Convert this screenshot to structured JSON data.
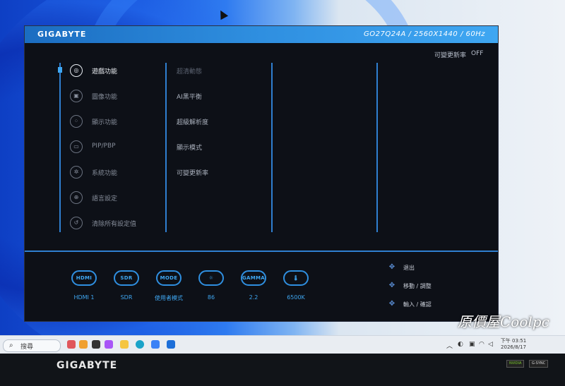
{
  "osd": {
    "brand": "GIGABYTE",
    "model_info": "GO27Q24A / 2560X1440 / 60Hz",
    "top_right_label": "可變更新率",
    "top_right_value": "OFF",
    "menu": [
      {
        "label": "遊戲功能",
        "icon": "gamepad-icon",
        "glyph": "◎",
        "active": true
      },
      {
        "label": "圖像功能",
        "icon": "picture-icon",
        "glyph": "▣",
        "active": false
      },
      {
        "label": "顯示功能",
        "icon": "display-icon",
        "glyph": "⁘",
        "active": false
      },
      {
        "label": "PIP/PBP",
        "icon": "pip-icon",
        "glyph": "▭",
        "active": false
      },
      {
        "label": "系統功能",
        "icon": "gear-icon",
        "glyph": "✲",
        "active": false
      },
      {
        "label": "語言設定",
        "icon": "globe-icon",
        "glyph": "⊕",
        "active": false
      },
      {
        "label": "清除所有設定值",
        "icon": "reset-icon",
        "glyph": "↺",
        "active": false
      }
    ],
    "submenu": [
      {
        "label": "超清動態",
        "dim": true
      },
      {
        "label": "AI黑平衡",
        "dim": false
      },
      {
        "label": "超級解析度",
        "dim": false
      },
      {
        "label": "顯示模式",
        "dim": false
      },
      {
        "label": "可變更新率",
        "dim": false
      }
    ],
    "status": [
      {
        "pill": "HDMI",
        "value": "HDMI 1",
        "icon": "hdmi-icon"
      },
      {
        "pill": "SDR",
        "value": "SDR",
        "icon": "sdr-icon"
      },
      {
        "pill": "MODE",
        "value": "使用者模式",
        "icon": "mode-icon"
      },
      {
        "pill": "☼",
        "value": "86",
        "icon": "brightness-icon"
      },
      {
        "pill": "GAMMA",
        "value": "2.2",
        "icon": "gamma-icon"
      },
      {
        "pill": "🌡",
        "value": "6500K",
        "icon": "color-temperature-icon"
      }
    ],
    "key_hints": [
      {
        "label": "退出",
        "icon": "joystick-exit-icon"
      },
      {
        "label": "移動 / 調整",
        "icon": "joystick-move-icon"
      },
      {
        "label": "輸入 / 確認",
        "icon": "joystick-enter-icon"
      }
    ]
  },
  "desktop": {
    "search_placeholder": "搜尋",
    "clock_time": "下午 03:51",
    "clock_date": "2026/8/17"
  },
  "monitor": {
    "bezel_brand": "GIGABYTE",
    "badge_nvidia": "NVIDIA",
    "badge_gsync": "G-SYNC"
  },
  "watermark": "原價屋Coolpc"
}
